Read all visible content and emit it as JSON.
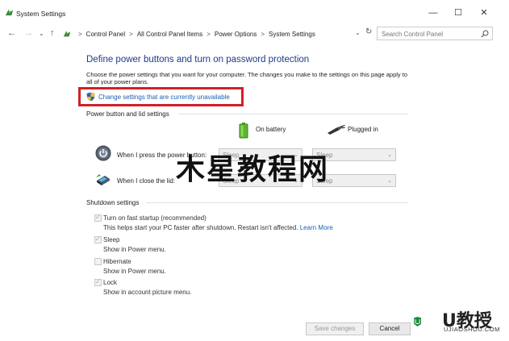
{
  "window": {
    "title": "System Settings",
    "minimize": "—",
    "maximize": "☐",
    "close": "✕"
  },
  "address": {
    "back": "←",
    "forward": "→",
    "recent": "⌄",
    "up": "↑",
    "crumbs": [
      "Control Panel",
      "All Control Panel Items",
      "Power Options",
      "System Settings"
    ],
    "separator": ">",
    "dropdown": "⌄",
    "refresh": "↻",
    "search_placeholder": "Search Control Panel"
  },
  "main": {
    "title": "Define power buttons and turn on password protection",
    "description": "Choose the power settings that you want for your computer. The changes you make to the settings on this page apply to all of your power plans.",
    "change_link": "Change settings that are currently unavailable"
  },
  "power_section": {
    "header": "Power button and lid settings",
    "col_battery": "On battery",
    "col_plugged": "Plugged in",
    "rows": [
      {
        "label": "When I press the power button:",
        "battery": "Sleep",
        "plugged": "Sleep"
      },
      {
        "label": "When I close the lid:",
        "battery": "Sleep",
        "plugged": "Sleep"
      }
    ]
  },
  "shutdown_section": {
    "header": "Shutdown settings",
    "items": [
      {
        "label": "Turn on fast startup (recommended)",
        "desc": "This helps start your PC faster after shutdown. Restart isn't affected.",
        "link": "Learn More",
        "checked": true
      },
      {
        "label": "Sleep",
        "desc": "Show in Power menu.",
        "checked": true
      },
      {
        "label": "Hibernate",
        "desc": "Show in Power menu.",
        "checked": false
      },
      {
        "label": "Lock",
        "desc": "Show in account picture menu.",
        "checked": true
      }
    ]
  },
  "buttons": {
    "save": "Save changes",
    "cancel": "Cancel"
  },
  "watermark": {
    "text": "木星教程网"
  },
  "logo": {
    "brand": "U教授",
    "url": "UJIAOSHOU.COM"
  },
  "colors": {
    "title_blue": "#1e3a8a",
    "link_blue": "#1a5fb4",
    "highlight_red": "#d0202a"
  }
}
